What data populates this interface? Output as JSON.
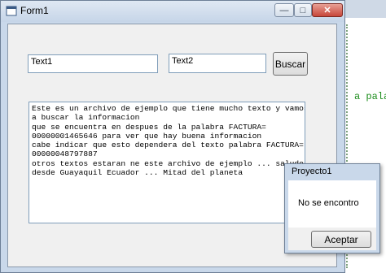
{
  "editor": {
    "code_fragment": "a palabr"
  },
  "form1": {
    "title": "Form1",
    "text1_value": "Text1",
    "text2_value": "Text2",
    "search_button_label": "Buscar",
    "memo_lines": [
      "Este es un archivo de ejemplo que tiene mucho texto y vamos",
      "a buscar la informacion",
      "que se encuentra en despues de la palabra FACTURA=",
      "00000001465646 para ver que hay buena informacion",
      "cabe indicar que esto dependera del texto palabra FACTURA=",
      "00000048797887",
      "otros textos estaran ne este archivo de ejemplo ... saludos",
      "desde Guayaquil Ecuador ... Mitad del planeta"
    ]
  },
  "msgbox": {
    "title": "Proyecto1",
    "message": "No se encontro",
    "accept_label": "Aceptar"
  },
  "colors": {
    "titlebar": "#c6d5e8",
    "close_button": "#c7463a",
    "code_green": "#1a8c1a"
  }
}
